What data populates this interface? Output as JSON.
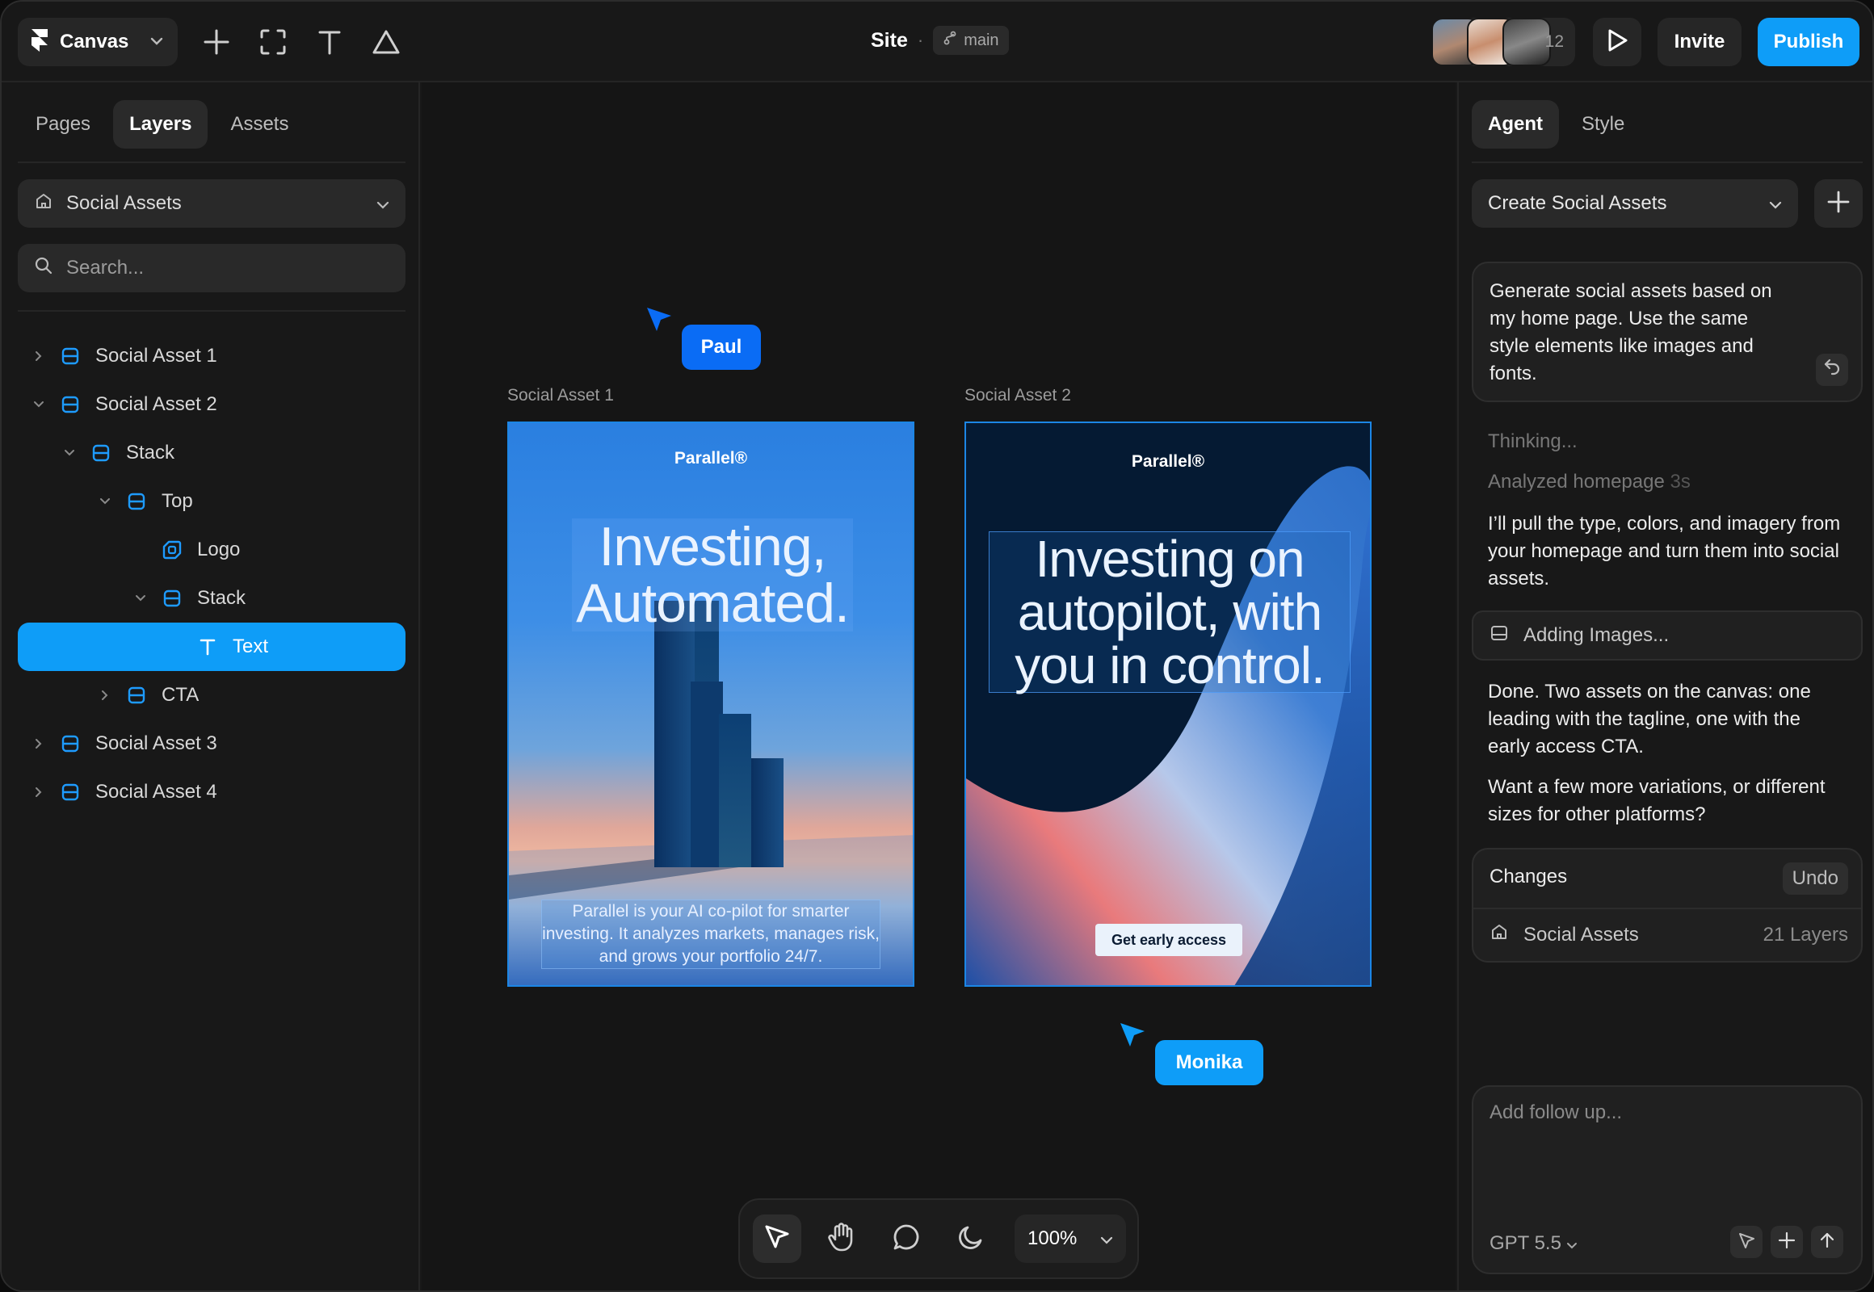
{
  "topbar": {
    "project_label": "Canvas",
    "site_title": "Site",
    "branch": "main",
    "collaborator_count": "12",
    "invite_label": "Invite",
    "publish_label": "Publish"
  },
  "left_panel": {
    "tabs": [
      "Pages",
      "Layers",
      "Assets"
    ],
    "active_tab": "Layers",
    "page_selector": "Social Assets",
    "search_placeholder": "Search...",
    "layers": [
      {
        "label": "Social Asset 1",
        "expanded": false
      },
      {
        "label": "Social Asset 2",
        "expanded": true
      },
      {
        "label": "Stack",
        "expanded": true
      },
      {
        "label": "Top",
        "expanded": true
      },
      {
        "label": "Logo"
      },
      {
        "label": "Stack",
        "expanded": true
      },
      {
        "label": "Text",
        "selected": true
      },
      {
        "label": "CTA",
        "expanded": false
      },
      {
        "label": "Social Asset 3",
        "expanded": false
      },
      {
        "label": "Social Asset 4",
        "expanded": false
      }
    ]
  },
  "canvas": {
    "frames": [
      {
        "label": "Social Asset 1",
        "brand": "Parallel®",
        "headline_line1": "Investing,",
        "headline_line2": "Automated.",
        "body": "Parallel is your AI co-pilot for smarter investing. It analyzes markets, manages risk, and grows your portfolio 24/7."
      },
      {
        "label": "Social Asset 2",
        "brand": "Parallel®",
        "headline_line1": "Investing on",
        "headline_line2": "autopilot, with",
        "headline_line3": "you in control.",
        "cta": "Get early access"
      }
    ],
    "cursors": [
      {
        "name": "Paul",
        "color": "#0a6cf5"
      },
      {
        "name": "Monika",
        "color": "#0e9df8"
      }
    ],
    "zoom": "100%"
  },
  "right_panel": {
    "tabs": [
      "Agent",
      "Style"
    ],
    "active_tab": "Agent",
    "task_selector": "Create Social Assets",
    "user_prompt": "Generate social assets based on my home page. Use the same style elements like images and fonts.",
    "status_thinking": "Thinking...",
    "status_analyzed": "Analyzed homepage",
    "status_analyzed_time": "3s",
    "reply_1": "I’ll pull the type, colors, and imagery from your homepage and turn them into social assets.",
    "progress_step": "Adding Images...",
    "reply_2": "Done. Two assets on the canvas: one leading with the tagline, one with the early access CTA.",
    "reply_3": "Want a few more variations, or different sizes for other platforms?",
    "changes": {
      "title": "Changes",
      "undo": "Undo",
      "item_label": "Social Assets",
      "item_count": "21 Layers"
    },
    "followup_placeholder": "Add follow up...",
    "model": "GPT 5.5"
  },
  "colors": {
    "accent": "#0e9df8",
    "panel": "#181818",
    "canvas": "#151515"
  }
}
